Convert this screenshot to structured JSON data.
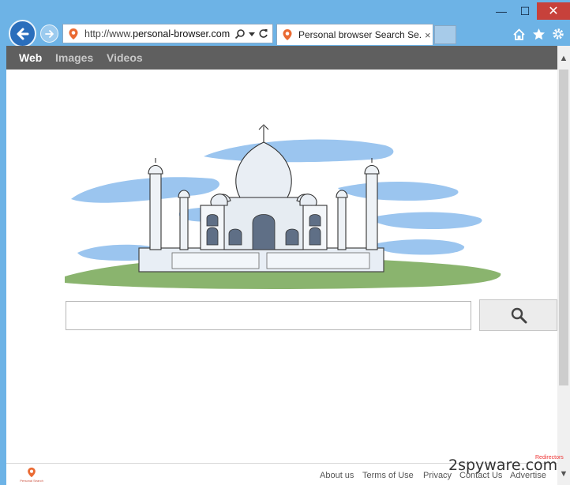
{
  "browser": {
    "address_url_prefix": "http://www.",
    "address_url_domain": "personal-browser.com",
    "tab_title": "Personal browser Search Se...",
    "tab_close": "×",
    "window_min": "—",
    "window_max": "☐",
    "window_close": "✕"
  },
  "nav": {
    "items": [
      {
        "label": "Web",
        "active": true
      },
      {
        "label": "Images",
        "active": false
      },
      {
        "label": "Videos",
        "active": false
      }
    ]
  },
  "search": {
    "input_value": "",
    "button_icon": "magnifier-icon"
  },
  "footer": {
    "logo_text": "Personal Search",
    "links": [
      "About us",
      "Terms of Use",
      "Privacy",
      "Contact Us",
      "Advertise"
    ]
  },
  "watermark": {
    "main": "2spyware.com",
    "sub": "Redirectors"
  },
  "icons": [
    "back-arrow-icon",
    "forward-arrow-icon",
    "search-icon",
    "dropdown-icon",
    "refresh-icon",
    "home-icon",
    "star-icon",
    "gear-icon"
  ],
  "colors": {
    "chrome_bg": "#6db3e6",
    "navbar_bg": "#5f5f5f",
    "close_button": "#c7413b",
    "brand_orange": "#ea6a32"
  }
}
